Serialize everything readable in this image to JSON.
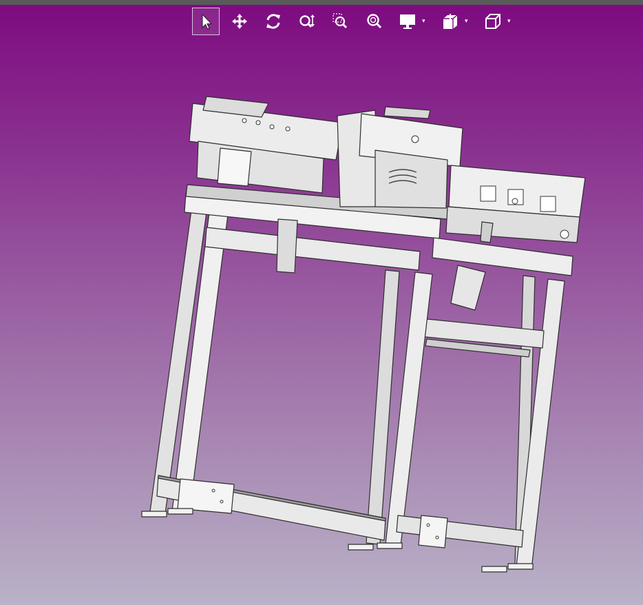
{
  "app": {
    "view": "3D model viewer"
  },
  "toolbar": {
    "tools": [
      {
        "name": "select",
        "icon": "cursor-arrow-icon",
        "active": true
      },
      {
        "name": "pan",
        "icon": "move-arrows-icon"
      },
      {
        "name": "rotate",
        "icon": "rotate-icon"
      },
      {
        "name": "zoom",
        "icon": "zoom-vertical-icon"
      },
      {
        "name": "zoom-window",
        "icon": "zoom-window-icon"
      },
      {
        "name": "zoom-fit",
        "icon": "zoom-fit-icon"
      },
      {
        "name": "display-mode",
        "icon": "monitor-icon",
        "dropdown": true
      },
      {
        "name": "section",
        "icon": "section-cube-icon",
        "dropdown": true
      },
      {
        "name": "standard-views",
        "icon": "cube-view-icon",
        "dropdown": true
      }
    ],
    "caret": "▾"
  },
  "colors": {
    "background_top": "#7d0a7f",
    "background_bottom": "#b9b2c8",
    "frame": "#eeeeee",
    "frame_shadow": "#4a4a4a"
  }
}
